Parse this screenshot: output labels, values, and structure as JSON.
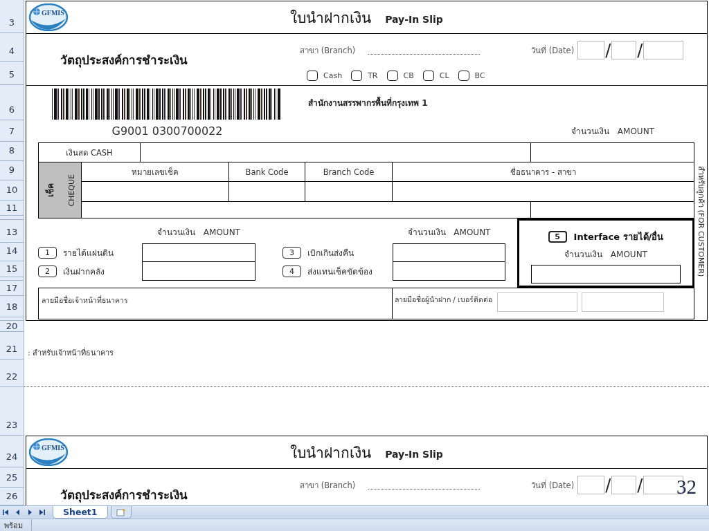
{
  "row_headers": [
    "3",
    "4",
    "5",
    "6",
    "7",
    "8",
    "9",
    "10",
    "11",
    "13",
    "14",
    "15",
    "17",
    "18",
    "20",
    "21",
    "22",
    "23",
    "24",
    "25",
    "26"
  ],
  "slips": [
    {
      "logo_text": "GFMIS",
      "title_th": "ใบนำฝากเงิน",
      "title_en": "Pay-In Slip",
      "purpose": "วัตถุประสงค์การชำระเงิน",
      "branch_label": "สาขา (Branch)",
      "date_label": "วันที่ (Date)",
      "date_separators": [
        "/",
        "/"
      ],
      "payment_types": [
        {
          "label": "Cash",
          "checked": false
        },
        {
          "label": "TR",
          "checked": false
        },
        {
          "label": "CB",
          "checked": false
        },
        {
          "label": "CL",
          "checked": false
        },
        {
          "label": "BC",
          "checked": false
        }
      ]
    },
    {
      "logo_text": "GFMIS",
      "title_th": "ใบนำฝากเงิน",
      "title_en": "Pay-In Slip",
      "purpose": "วัตถุประสงค์การชำระเงิน",
      "branch_label": "สาขา (Branch)",
      "date_label": "วันที่ (Date)",
      "date_separators": [
        "/",
        "/"
      ]
    }
  ],
  "barcode_number": "G9001 0300700022",
  "office": "สำนักงานสรรพากรพื้นที่กรุงเทพ 1",
  "amount_header": "จำนวนเงิน AMOUNT",
  "cash_row": {
    "label": "เงินสด CASH"
  },
  "cheque": {
    "label_th": "เช็ค",
    "label_en": "CHEQUE",
    "columns": [
      "หมายเลขเช็ค",
      "Bank Code",
      "Branch Code",
      "ชื่อธนาคาร - สาขา"
    ]
  },
  "deposit_groups": [
    {
      "amount_header": "จำนวนเงิน AMOUNT",
      "items": [
        {
          "number": "1",
          "label": "รายได้แผ่นดิน"
        },
        {
          "number": "2",
          "label": "เงินฝากคลัง"
        }
      ]
    },
    {
      "amount_header": "จำนวนเงิน AMOUNT",
      "items": [
        {
          "number": "3",
          "label": "เบิกเกินส่งคืน"
        },
        {
          "number": "4",
          "label": "ส่งแทนเช็คขัดข้อง"
        }
      ]
    }
  ],
  "interface_box": {
    "number": "5",
    "label": "Interface รายได้/อื่น",
    "amount_header": "จำนวนเงิน AMOUNT"
  },
  "signatures": {
    "bank_officer": "ลายมือชื่อเจ้าหน้าที่ธนาคาร",
    "depositor": "ลายมือชื่อผู้นำฝาก / เบอร์ติดต่อ"
  },
  "customer_copy_label": "สำหรับลูกค้า (FOR CUSTOMER)",
  "bank_copy_label": ": สำหรับเจ้าหน้าที่ธนาคาร",
  "page_number": "32",
  "sheet_tabs": [
    {
      "label": "Sheet1",
      "selected": true
    }
  ],
  "status_bar": {
    "text": "พร้อม"
  }
}
